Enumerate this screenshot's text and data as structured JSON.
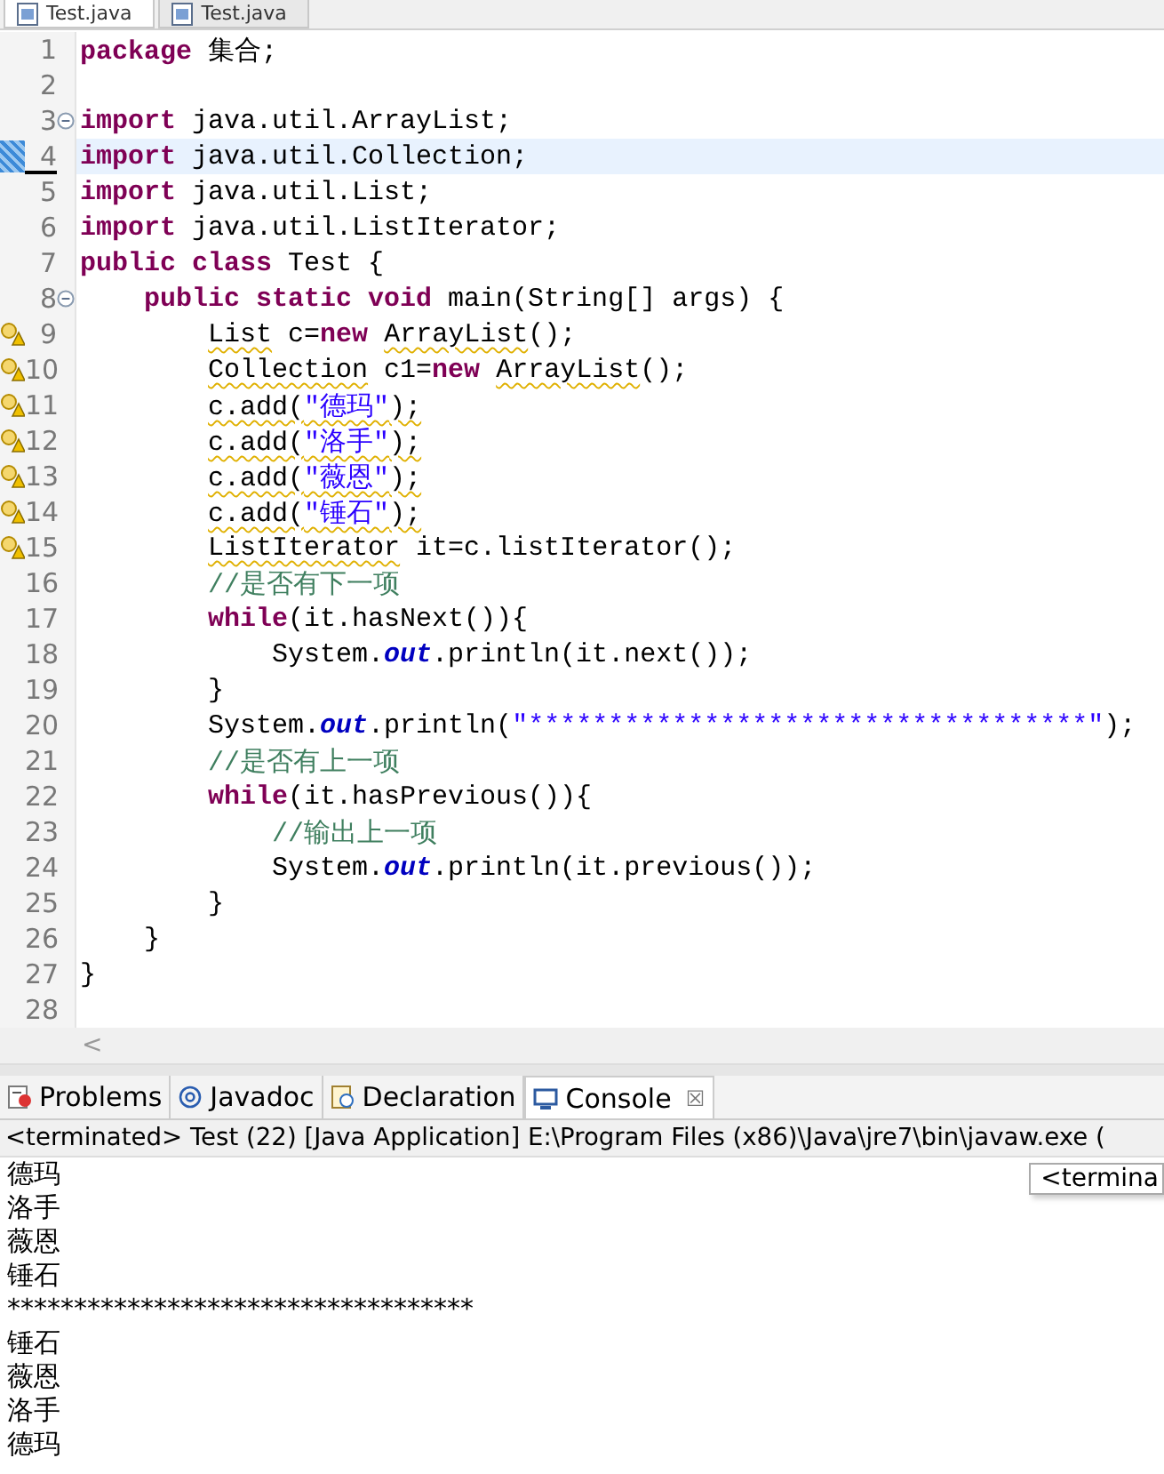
{
  "editor_tabs": [
    {
      "label": "Test.java",
      "selected": true
    },
    {
      "label": "Test.java",
      "selected": false
    }
  ],
  "editor": {
    "lines": [
      {
        "number": "1",
        "segments": [
          {
            "kind": "keyword",
            "text": "package"
          },
          {
            "kind": "plain",
            "text": " 集合;"
          }
        ]
      },
      {
        "number": "2"
      },
      {
        "number": "3",
        "fold": true,
        "segments": [
          {
            "kind": "keyword",
            "text": "import"
          },
          {
            "kind": "plain",
            "text": " java.util.ArrayList;"
          }
        ]
      },
      {
        "number": "4",
        "current": true,
        "segments": [
          {
            "kind": "keyword",
            "text": "import"
          },
          {
            "kind": "plain",
            "text": " java.util.Collection;"
          }
        ]
      },
      {
        "number": "5",
        "segments": [
          {
            "kind": "keyword",
            "text": "import"
          },
          {
            "kind": "plain",
            "text": " java.util.List;"
          }
        ]
      },
      {
        "number": "6",
        "segments": [
          {
            "kind": "keyword",
            "text": "import"
          },
          {
            "kind": "plain",
            "text": " java.util.ListIterator;"
          }
        ]
      },
      {
        "number": "7",
        "segments": [
          {
            "kind": "keyword",
            "text": "public"
          },
          {
            "kind": "keyword",
            "text": " class"
          },
          {
            "kind": "plain",
            "text": " Test {"
          }
        ]
      },
      {
        "number": "8",
        "fold": true,
        "segments": [
          {
            "kind": "keyword",
            "text": "    public"
          },
          {
            "kind": "keyword",
            "text": " static"
          },
          {
            "kind": "keyword",
            "text": " void"
          },
          {
            "kind": "plain",
            "text": " main(String[] args) {"
          }
        ]
      },
      {
        "number": "9",
        "warning": true,
        "segments": [
          {
            "kind": "plain",
            "text": "        List",
            "squiggle": true
          },
          {
            "kind": "plain",
            "text": " c="
          },
          {
            "kind": "keyword",
            "text": "new"
          },
          {
            "kind": "plain",
            "text": " ArrayList",
            "squiggle": true
          },
          {
            "kind": "plain",
            "text": "();"
          }
        ]
      },
      {
        "number": "10",
        "warning": true,
        "segments": [
          {
            "kind": "plain",
            "text": "        Collection",
            "squiggle": true
          },
          {
            "kind": "plain",
            "text": " c1="
          },
          {
            "kind": "keyword",
            "text": "new"
          },
          {
            "kind": "plain",
            "text": " ArrayList",
            "squiggle": true
          },
          {
            "kind": "plain",
            "text": "();"
          }
        ]
      },
      {
        "number": "11",
        "warning": true,
        "segments": [
          {
            "kind": "plain",
            "text": "        c.add(",
            "squiggle": true
          },
          {
            "kind": "string",
            "text": "\"德玛\"",
            "squiggle": true
          },
          {
            "kind": "plain",
            "text": ");",
            "squiggle": true
          }
        ]
      },
      {
        "number": "12",
        "warning": true,
        "segments": [
          {
            "kind": "plain",
            "text": "        c.add(",
            "squiggle": true
          },
          {
            "kind": "string",
            "text": "\"洛手\"",
            "squiggle": true
          },
          {
            "kind": "plain",
            "text": ");",
            "squiggle": true
          }
        ]
      },
      {
        "number": "13",
        "warning": true,
        "segments": [
          {
            "kind": "plain",
            "text": "        c.add(",
            "squiggle": true
          },
          {
            "kind": "string",
            "text": "\"薇恩\"",
            "squiggle": true
          },
          {
            "kind": "plain",
            "text": ");",
            "squiggle": true
          }
        ]
      },
      {
        "number": "14",
        "warning": true,
        "segments": [
          {
            "kind": "plain",
            "text": "        c.add(",
            "squiggle": true
          },
          {
            "kind": "string",
            "text": "\"锤石\"",
            "squiggle": true
          },
          {
            "kind": "plain",
            "text": ");",
            "squiggle": true
          }
        ]
      },
      {
        "number": "15",
        "warning": true,
        "segments": [
          {
            "kind": "plain",
            "text": "        ListIterator",
            "squiggle": true
          },
          {
            "kind": "plain",
            "text": " it=c.listIterator();"
          }
        ]
      },
      {
        "number": "16",
        "segments": [
          {
            "kind": "comment",
            "text": "        //是否有下一项"
          }
        ]
      },
      {
        "number": "17",
        "segments": [
          {
            "kind": "keyword",
            "text": "        while"
          },
          {
            "kind": "plain",
            "text": "(it.hasNext()){"
          }
        ]
      },
      {
        "number": "18",
        "segments": [
          {
            "kind": "plain",
            "text": "            System."
          },
          {
            "kind": "field",
            "text": "out"
          },
          {
            "kind": "plain",
            "text": ".println(it.next());"
          }
        ]
      },
      {
        "number": "19",
        "segments": [
          {
            "kind": "plain",
            "text": "        }"
          }
        ]
      },
      {
        "number": "20",
        "segments": [
          {
            "kind": "plain",
            "text": "        System."
          },
          {
            "kind": "field",
            "text": "out"
          },
          {
            "kind": "plain",
            "text": ".println("
          },
          {
            "kind": "string",
            "text": "\"***********************************\""
          },
          {
            "kind": "plain",
            "text": ");"
          }
        ]
      },
      {
        "number": "21",
        "segments": [
          {
            "kind": "comment",
            "text": "        //是否有上一项"
          }
        ]
      },
      {
        "number": "22",
        "segments": [
          {
            "kind": "keyword",
            "text": "        while"
          },
          {
            "kind": "plain",
            "text": "(it.hasPrevious()){"
          }
        ]
      },
      {
        "number": "23",
        "segments": [
          {
            "kind": "comment",
            "text": "            //输出上一项"
          }
        ]
      },
      {
        "number": "24",
        "segments": [
          {
            "kind": "plain",
            "text": "            System."
          },
          {
            "kind": "field",
            "text": "out"
          },
          {
            "kind": "plain",
            "text": ".println(it.previous());"
          }
        ]
      },
      {
        "number": "25",
        "segments": [
          {
            "kind": "plain",
            "text": "        }"
          }
        ]
      },
      {
        "number": "26",
        "segments": [
          {
            "kind": "plain",
            "text": "    }"
          }
        ]
      },
      {
        "number": "27",
        "segments": [
          {
            "kind": "plain",
            "text": "}"
          }
        ]
      },
      {
        "number": "28"
      }
    ],
    "scroll_arrow": "<"
  },
  "panel_tabs": [
    {
      "label": "Problems",
      "selected": false
    },
    {
      "label": "Javadoc",
      "selected": false
    },
    {
      "label": "Declaration",
      "selected": false
    },
    {
      "label": "Console",
      "selected": true,
      "close": "☒"
    }
  ],
  "console": {
    "header": "<terminated> Test (22) [Java Application] E:\\Program Files (x86)\\Java\\jre7\\bin\\javaw.exe (",
    "tooltip": "<termina",
    "output": [
      "德玛",
      "洛手",
      "薇恩",
      "锤石",
      "***********************************",
      "锤石",
      "薇恩",
      "洛手",
      "德玛"
    ]
  }
}
